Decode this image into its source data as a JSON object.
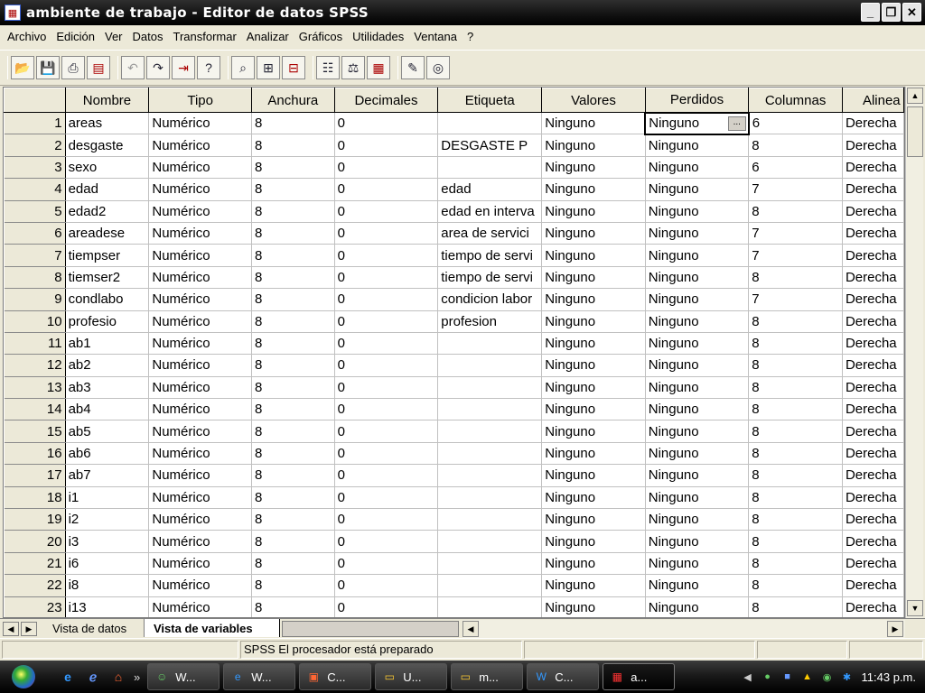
{
  "window": {
    "title": "ambiente de trabajo - Editor de datos SPSS"
  },
  "menu": [
    "Archivo",
    "Edición",
    "Ver",
    "Datos",
    "Transformar",
    "Analizar",
    "Gráficos",
    "Utilidades",
    "Ventana",
    "?"
  ],
  "columns": [
    "Nombre",
    "Tipo",
    "Anchura",
    "Decimales",
    "Etiqueta",
    "Valores",
    "Perdidos",
    "Columnas",
    "Alinea"
  ],
  "rows": [
    {
      "n": "1",
      "nombre": "areas",
      "tipo": "Numérico",
      "anchura": "8",
      "decimales": "0",
      "etiqueta": "",
      "valores": "Ninguno",
      "perdidos": "Ninguno",
      "columnas": "6",
      "alinea": "Derecha"
    },
    {
      "n": "2",
      "nombre": "desgaste",
      "tipo": "Numérico",
      "anchura": "8",
      "decimales": "0",
      "etiqueta": "DESGASTE P",
      "valores": "Ninguno",
      "perdidos": "Ninguno",
      "columnas": "8",
      "alinea": "Derecha"
    },
    {
      "n": "3",
      "nombre": "sexo",
      "tipo": "Numérico",
      "anchura": "8",
      "decimales": "0",
      "etiqueta": "",
      "valores": "Ninguno",
      "perdidos": "Ninguno",
      "columnas": "6",
      "alinea": "Derecha"
    },
    {
      "n": "4",
      "nombre": "edad",
      "tipo": "Numérico",
      "anchura": "8",
      "decimales": "0",
      "etiqueta": "edad",
      "valores": "Ninguno",
      "perdidos": "Ninguno",
      "columnas": "7",
      "alinea": "Derecha"
    },
    {
      "n": "5",
      "nombre": "edad2",
      "tipo": "Numérico",
      "anchura": "8",
      "decimales": "0",
      "etiqueta": "edad en interva",
      "valores": "Ninguno",
      "perdidos": "Ninguno",
      "columnas": "8",
      "alinea": "Derecha"
    },
    {
      "n": "6",
      "nombre": "areadese",
      "tipo": "Numérico",
      "anchura": "8",
      "decimales": "0",
      "etiqueta": "area de servici",
      "valores": "Ninguno",
      "perdidos": "Ninguno",
      "columnas": "7",
      "alinea": "Derecha"
    },
    {
      "n": "7",
      "nombre": "tiempser",
      "tipo": "Numérico",
      "anchura": "8",
      "decimales": "0",
      "etiqueta": "tiempo de servi",
      "valores": "Ninguno",
      "perdidos": "Ninguno",
      "columnas": "7",
      "alinea": "Derecha"
    },
    {
      "n": "8",
      "nombre": "tiemser2",
      "tipo": "Numérico",
      "anchura": "8",
      "decimales": "0",
      "etiqueta": "tiempo de servi",
      "valores": "Ninguno",
      "perdidos": "Ninguno",
      "columnas": "8",
      "alinea": "Derecha"
    },
    {
      "n": "9",
      "nombre": "condlabo",
      "tipo": "Numérico",
      "anchura": "8",
      "decimales": "0",
      "etiqueta": "condicion labor",
      "valores": "Ninguno",
      "perdidos": "Ninguno",
      "columnas": "7",
      "alinea": "Derecha"
    },
    {
      "n": "10",
      "nombre": "profesio",
      "tipo": "Numérico",
      "anchura": "8",
      "decimales": "0",
      "etiqueta": "profesion",
      "valores": "Ninguno",
      "perdidos": "Ninguno",
      "columnas": "8",
      "alinea": "Derecha"
    },
    {
      "n": "11",
      "nombre": "ab1",
      "tipo": "Numérico",
      "anchura": "8",
      "decimales": "0",
      "etiqueta": "",
      "valores": "Ninguno",
      "perdidos": "Ninguno",
      "columnas": "8",
      "alinea": "Derecha"
    },
    {
      "n": "12",
      "nombre": "ab2",
      "tipo": "Numérico",
      "anchura": "8",
      "decimales": "0",
      "etiqueta": "",
      "valores": "Ninguno",
      "perdidos": "Ninguno",
      "columnas": "8",
      "alinea": "Derecha"
    },
    {
      "n": "13",
      "nombre": "ab3",
      "tipo": "Numérico",
      "anchura": "8",
      "decimales": "0",
      "etiqueta": "",
      "valores": "Ninguno",
      "perdidos": "Ninguno",
      "columnas": "8",
      "alinea": "Derecha"
    },
    {
      "n": "14",
      "nombre": "ab4",
      "tipo": "Numérico",
      "anchura": "8",
      "decimales": "0",
      "etiqueta": "",
      "valores": "Ninguno",
      "perdidos": "Ninguno",
      "columnas": "8",
      "alinea": "Derecha"
    },
    {
      "n": "15",
      "nombre": "ab5",
      "tipo": "Numérico",
      "anchura": "8",
      "decimales": "0",
      "etiqueta": "",
      "valores": "Ninguno",
      "perdidos": "Ninguno",
      "columnas": "8",
      "alinea": "Derecha"
    },
    {
      "n": "16",
      "nombre": "ab6",
      "tipo": "Numérico",
      "anchura": "8",
      "decimales": "0",
      "etiqueta": "",
      "valores": "Ninguno",
      "perdidos": "Ninguno",
      "columnas": "8",
      "alinea": "Derecha"
    },
    {
      "n": "17",
      "nombre": "ab7",
      "tipo": "Numérico",
      "anchura": "8",
      "decimales": "0",
      "etiqueta": "",
      "valores": "Ninguno",
      "perdidos": "Ninguno",
      "columnas": "8",
      "alinea": "Derecha"
    },
    {
      "n": "18",
      "nombre": "i1",
      "tipo": "Numérico",
      "anchura": "8",
      "decimales": "0",
      "etiqueta": "",
      "valores": "Ninguno",
      "perdidos": "Ninguno",
      "columnas": "8",
      "alinea": "Derecha"
    },
    {
      "n": "19",
      "nombre": "i2",
      "tipo": "Numérico",
      "anchura": "8",
      "decimales": "0",
      "etiqueta": "",
      "valores": "Ninguno",
      "perdidos": "Ninguno",
      "columnas": "8",
      "alinea": "Derecha"
    },
    {
      "n": "20",
      "nombre": "i3",
      "tipo": "Numérico",
      "anchura": "8",
      "decimales": "0",
      "etiqueta": "",
      "valores": "Ninguno",
      "perdidos": "Ninguno",
      "columnas": "8",
      "alinea": "Derecha"
    },
    {
      "n": "21",
      "nombre": "i6",
      "tipo": "Numérico",
      "anchura": "8",
      "decimales": "0",
      "etiqueta": "",
      "valores": "Ninguno",
      "perdidos": "Ninguno",
      "columnas": "8",
      "alinea": "Derecha"
    },
    {
      "n": "22",
      "nombre": "i8",
      "tipo": "Numérico",
      "anchura": "8",
      "decimales": "0",
      "etiqueta": "",
      "valores": "Ninguno",
      "perdidos": "Ninguno",
      "columnas": "8",
      "alinea": "Derecha"
    },
    {
      "n": "23",
      "nombre": "i13",
      "tipo": "Numérico",
      "anchura": "8",
      "decimales": "0",
      "etiqueta": "",
      "valores": "Ninguno",
      "perdidos": "Ninguno",
      "columnas": "8",
      "alinea": "Derecha"
    }
  ],
  "tabs": {
    "data_view": "Vista de datos",
    "variable_view": "Vista de variables"
  },
  "status": {
    "text": "SPSS El procesador  está preparado"
  },
  "taskbar": {
    "items": [
      "W...",
      "W...",
      "C...",
      "U...",
      "m...",
      "C...",
      "a..."
    ],
    "clock": "11:43 p.m."
  }
}
